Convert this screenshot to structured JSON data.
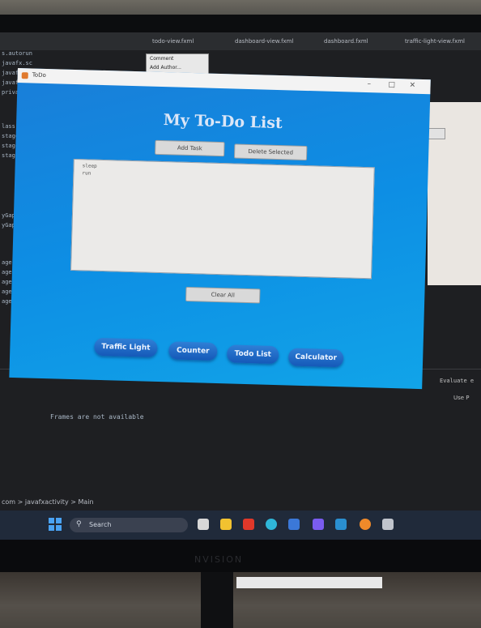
{
  "ide": {
    "tabs": [
      "todo-view.fxml",
      "dashboard-view.fxml",
      "dashboard.fxml",
      "traffic-light-view.fxml"
    ],
    "code_fragments": [
      "s.autorun",
      "javafx.sc",
      "javafx.fx",
      "javafx.sce",
      "private.Sta",
      "",
      "lass Main",
      "stage.setSce",
      "stage.setTi",
      "stage.show()",
      "",
      "",
      "yGap",
      "yGap",
      "age.set",
      "age.set",
      "age.set",
      "age.set",
      "age.show"
    ],
    "frames_message": "Frames are not available",
    "breadcrumb": "com > javafxactivity > Main",
    "right_panel_text": "Evaluate e",
    "right_panel_text2": "Use P"
  },
  "mini_dialog": {
    "line1": "Comment",
    "line2": "Add Author..."
  },
  "app": {
    "window_title": "ToDo",
    "heading": "My To-Do List",
    "add_task_label": "Add Task",
    "delete_selected_label": "Delete Selected",
    "clear_all_label": "Clear All",
    "task_lines": [
      "sleep",
      "run"
    ],
    "nav_buttons": [
      "Traffic Light",
      "Counter",
      "Todo List",
      "Calculator"
    ]
  },
  "taskbar": {
    "search_placeholder": "Search"
  },
  "monitor": {
    "brand": "NVISION"
  }
}
